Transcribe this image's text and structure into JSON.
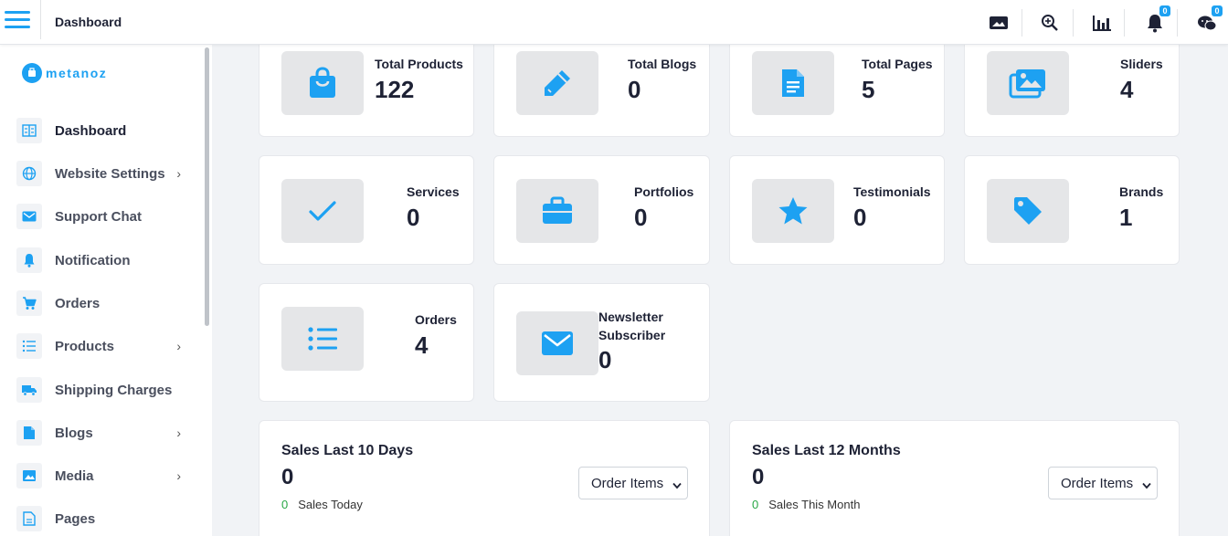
{
  "topbar": {
    "title": "Dashboard",
    "notification_count": "0",
    "chat_count": "0"
  },
  "sidebar": {
    "logo_text": "metanoz",
    "items": [
      {
        "label": "Dashboard",
        "icon": "dashboard-icon",
        "has_submenu": false
      },
      {
        "label": "Website Settings",
        "icon": "globe-icon",
        "has_submenu": true
      },
      {
        "label": "Support Chat",
        "icon": "envelope-icon",
        "has_submenu": false
      },
      {
        "label": "Notification",
        "icon": "bell-icon",
        "has_submenu": false
      },
      {
        "label": "Orders",
        "icon": "cart-icon",
        "has_submenu": false
      },
      {
        "label": "Products",
        "icon": "list-icon",
        "has_submenu": true
      },
      {
        "label": "Shipping Charges",
        "icon": "truck-icon",
        "has_submenu": false
      },
      {
        "label": "Blogs",
        "icon": "file-icon",
        "has_submenu": true
      },
      {
        "label": "Media",
        "icon": "image-icon",
        "has_submenu": true
      },
      {
        "label": "Pages",
        "icon": "document-icon",
        "has_submenu": false
      }
    ]
  },
  "stats": [
    {
      "label": "Total Products",
      "value": "122",
      "icon": "shopping-bag-icon"
    },
    {
      "label": "Total Blogs",
      "value": "0",
      "icon": "pencil-icon"
    },
    {
      "label": "Total Pages",
      "value": "5",
      "icon": "document-icon"
    },
    {
      "label": "Sliders",
      "value": "4",
      "icon": "images-icon"
    },
    {
      "label": "Services",
      "value": "0",
      "icon": "check-icon"
    },
    {
      "label": "Portfolios",
      "value": "0",
      "icon": "briefcase-icon"
    },
    {
      "label": "Testimonials",
      "value": "0",
      "icon": "star-icon"
    },
    {
      "label": "Brands",
      "value": "1",
      "icon": "tag-icon"
    },
    {
      "label": "Orders",
      "value": "4",
      "icon": "list-icon"
    },
    {
      "label": "Newsletter Subscriber",
      "value": "0",
      "icon": "envelope-icon"
    }
  ],
  "sales": [
    {
      "title": "Sales Last 10 Days",
      "value": "0",
      "sub_value": "0",
      "sub_label": "Sales Today",
      "select_value": "Order Items"
    },
    {
      "title": "Sales Last 12 Months",
      "value": "0",
      "sub_value": "0",
      "sub_label": "Sales This Month",
      "select_value": "Order Items"
    }
  ],
  "colors": {
    "accent": "#1da1f2",
    "text": "#1e2235",
    "success": "#28a745",
    "icon_bg": "#e5e6e8"
  }
}
